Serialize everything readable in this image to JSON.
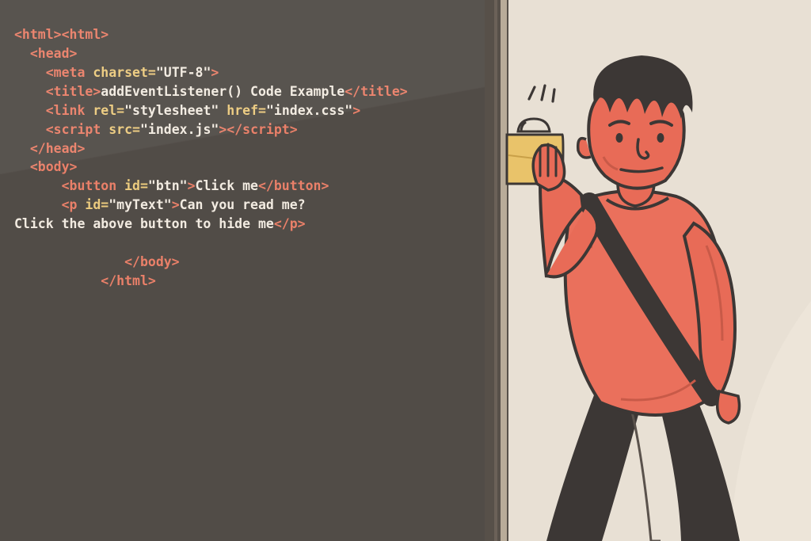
{
  "code": {
    "line1_a": "<html>",
    "line1_b": "<html>",
    "line2": "<head>",
    "line3": {
      "tag_open": "<meta",
      "attr1": "charset",
      "val1": "\"UTF-8\"",
      "close": ">"
    },
    "line4": {
      "tag_open": "<title>",
      "content": "addEventListener() Code Example",
      "tag_close": "</title>"
    },
    "line5": {
      "tag_open": "<link",
      "attr1": "rel",
      "val1": "\"stylesheet\"",
      "attr2": "href",
      "val2": "\"index.css\"",
      "close": ">"
    },
    "line6": {
      "tag_open": "<script",
      "attr1": "src",
      "val1": "\"index.js\"",
      "close_open": ">",
      "tag_close": "</script>"
    },
    "line7": "</head>",
    "line8": "<body>",
    "line9": {
      "tag_open": "<button",
      "attr1": "id",
      "val1": "\"btn\"",
      "close": ">",
      "content": "Click me",
      "tag_close": "</button>"
    },
    "line10": {
      "tag_open": "<p",
      "attr1": "id",
      "val1": "\"myText\"",
      "close": ">",
      "content": "Can you read me?"
    },
    "line11": {
      "content": "Click the above button to hide me",
      "tag_close": "</p>"
    },
    "line13": "</body>",
    "line14": "</html>"
  },
  "colors": {
    "bg_code": "#514C47",
    "bg_illu": "#E8E0D4",
    "tag": "#EA8069",
    "attr": "#ECCB7E",
    "text": "#F2EBE1",
    "person_skin": "#E86B57",
    "person_shirt": "#EA705C",
    "person_dark": "#3C3735",
    "cup": "#E9C36A",
    "wall_dark": "#575049"
  }
}
